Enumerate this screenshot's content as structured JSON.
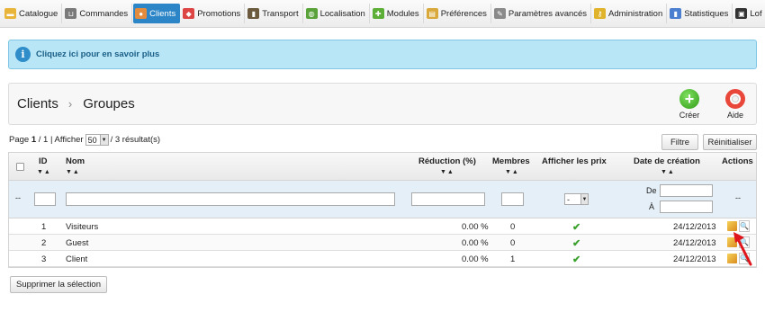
{
  "nav": {
    "items": [
      {
        "label": "Catalogue",
        "icon": "folder-icon",
        "color": "#e8b53a"
      },
      {
        "label": "Commandes",
        "icon": "cart-icon",
        "color": "#7a7a7a"
      },
      {
        "label": "Clients",
        "icon": "user-icon",
        "color": "#e38b3c"
      },
      {
        "label": "Promotions",
        "icon": "promotion-icon",
        "color": "#d44"
      },
      {
        "label": "Transport",
        "icon": "truck-icon",
        "color": "#6b5a3d"
      },
      {
        "label": "Localisation",
        "icon": "globe-icon",
        "color": "#5aa33a"
      },
      {
        "label": "Modules",
        "icon": "puzzle-icon",
        "color": "#5cae36"
      },
      {
        "label": "Préférences",
        "icon": "preferences-icon",
        "color": "#d8a93a"
      },
      {
        "label": "Paramètres avancés",
        "icon": "wrench-icon",
        "color": "#8a8a8a"
      },
      {
        "label": "Administration",
        "icon": "key-icon",
        "color": "#e0b32c"
      },
      {
        "label": "Statistiques",
        "icon": "bar-chart-icon",
        "color": "#4c7fcf"
      },
      {
        "label": "Lof Blogs",
        "icon": "lock-icon",
        "color": "#333333"
      }
    ],
    "active": "Clients",
    "active_color": "#2b85c6"
  },
  "info": {
    "text": "Cliquez ici pour en savoir plus"
  },
  "toolbar": {
    "breadcrumb_parent": "Clients",
    "breadcrumb_current": "Groupes",
    "create_label": "Créer",
    "help_label": "Aide"
  },
  "pagination": {
    "page_prefix": "Page",
    "page_current": "1",
    "page_total": "/ 1",
    "show_label": "| Afficher",
    "per_page": "50",
    "results": "/ 3 résultat(s)"
  },
  "buttons": {
    "filter": "Filtre",
    "reset": "Réinitialiser",
    "delete_selection": "Supprimer la sélection"
  },
  "table": {
    "headers": {
      "id": "ID",
      "name": "Nom",
      "reduction": "Réduction (%)",
      "members": "Membres",
      "show_prices": "Afficher les prix",
      "date": "Date de création",
      "actions": "Actions"
    },
    "sort_arrows": "▼▲",
    "filter": {
      "dash": "--",
      "select_value": "-",
      "date_from": "De",
      "date_to": "À",
      "actions_dash": "--"
    },
    "rows": [
      {
        "id": "1",
        "name": "Visiteurs",
        "reduction": "0.00 %",
        "members": "0",
        "date": "24/12/2013"
      },
      {
        "id": "2",
        "name": "Guest",
        "reduction": "0.00 %",
        "members": "0",
        "date": "24/12/2013"
      },
      {
        "id": "3",
        "name": "Client",
        "reduction": "0.00 %",
        "members": "1",
        "date": "24/12/2013"
      }
    ],
    "check_color": "#3aa12c"
  },
  "annotation_arrow_color": "#e0141b"
}
